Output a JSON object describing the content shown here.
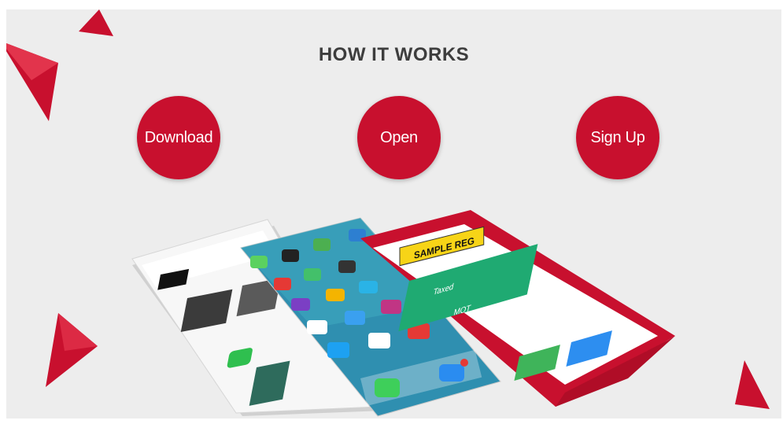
{
  "heading": "HOW IT WORKS",
  "steps": [
    {
      "label": "Download"
    },
    {
      "label": "Open"
    },
    {
      "label": "Sign Up"
    }
  ],
  "screen": {
    "plate": "SAMPLE REG",
    "status_rows": [
      {
        "label": "Taxed"
      },
      {
        "label": "MOT"
      }
    ]
  },
  "colors": {
    "accent": "#c8102e",
    "background": "#ededed",
    "heading": "#3d3d3d",
    "status_green": "#1faa72"
  }
}
